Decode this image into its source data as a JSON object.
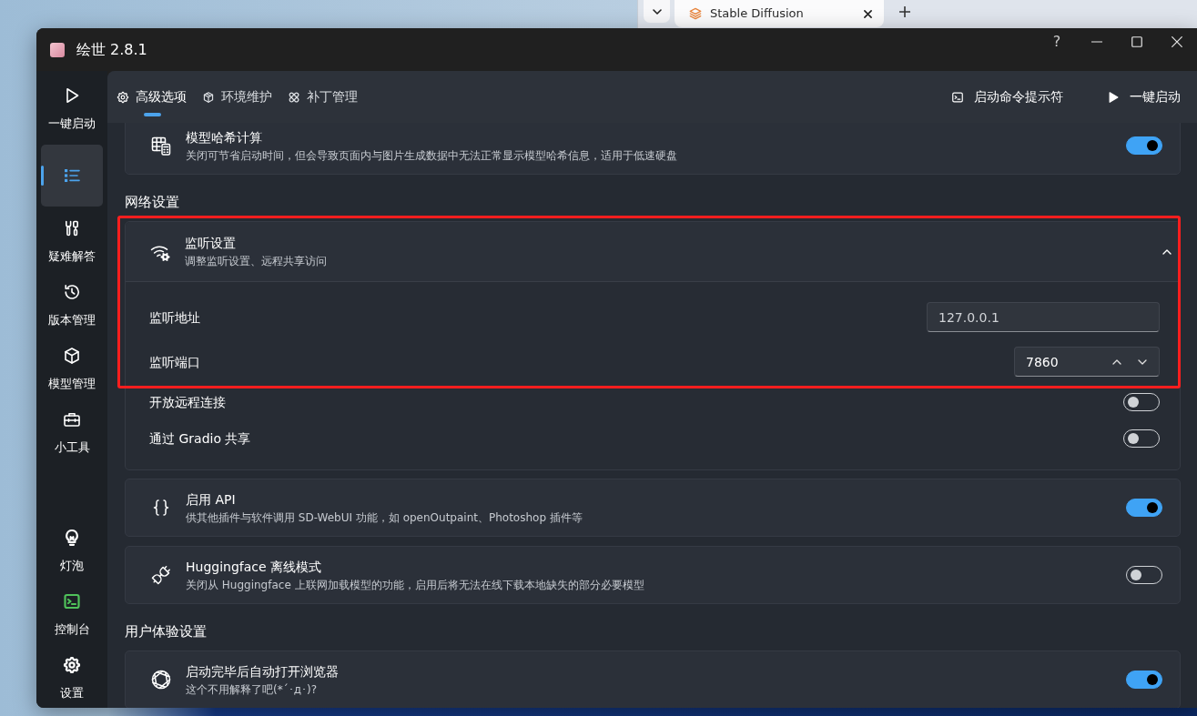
{
  "browser": {
    "tab_title": "Stable Diffusion"
  },
  "window": {
    "title": "绘世 2.8.1",
    "help": "?"
  },
  "sidebar": {
    "items": [
      {
        "label": "一键启动",
        "selected": false
      },
      {
        "selected": true
      },
      {
        "label": "疑难解答",
        "selected": false
      },
      {
        "label": "版本管理",
        "selected": false
      },
      {
        "label": "模型管理",
        "selected": false
      },
      {
        "label": "小工具",
        "selected": false
      }
    ],
    "bottom_items": [
      {
        "label": "灯泡",
        "color": "#ffffff",
        "selected": false
      },
      {
        "label": "控制台",
        "color": "#4fc15a",
        "selected": false
      },
      {
        "label": "设置",
        "color": "#ffffff",
        "selected": false
      }
    ]
  },
  "nav": {
    "tabs": [
      {
        "label": "高级选项",
        "selected": true
      },
      {
        "label": "环境维护",
        "selected": false
      },
      {
        "label": "补丁管理",
        "selected": false
      }
    ],
    "actions": [
      {
        "label": "启动命令提示符"
      },
      {
        "label": "一键启动"
      }
    ]
  },
  "settings": [
    {
      "kind": "card",
      "title": "模型哈希计算",
      "description": "关闭可节省启动时间，但会导致页面内与图片生成数据中无法正常显示模型哈希信息，适用于低速硬盘",
      "on": true
    },
    {
      "kind": "heading",
      "text": "网络设置"
    },
    {
      "kind": "expander",
      "title": "监听设置",
      "description": "调整监听设置、远程共享访问",
      "expanded": true,
      "highlighted": true,
      "rows": [
        {
          "kind": "text",
          "label": "监听地址",
          "value": "127.0.0.1",
          "highlighted": true
        },
        {
          "kind": "number",
          "label": "监听端口",
          "value": "7860",
          "highlighted": true
        },
        {
          "kind": "toggle",
          "label": "开放远程连接",
          "on": false,
          "highlighted": false
        },
        {
          "kind": "toggle",
          "label": "通过 Gradio 共享",
          "on": false,
          "highlighted": false
        }
      ]
    },
    {
      "kind": "card",
      "title": "启用 API",
      "description": "供其他插件与软件调用 SD-WebUI 功能，如 openOutpaint、Photoshop 插件等",
      "on": true
    },
    {
      "kind": "card",
      "title": "Huggingface 离线模式",
      "description": "关闭从 Huggingface 上联网加载模型的功能，启用后将无法在线下载本地缺失的部分必要模型",
      "on": false
    },
    {
      "kind": "heading",
      "text": "用户体验设置"
    },
    {
      "kind": "card",
      "title": "启动完毕后自动打开浏览器",
      "description": "这个不用解释了吧(*´･д･)?",
      "on": true
    }
  ]
}
